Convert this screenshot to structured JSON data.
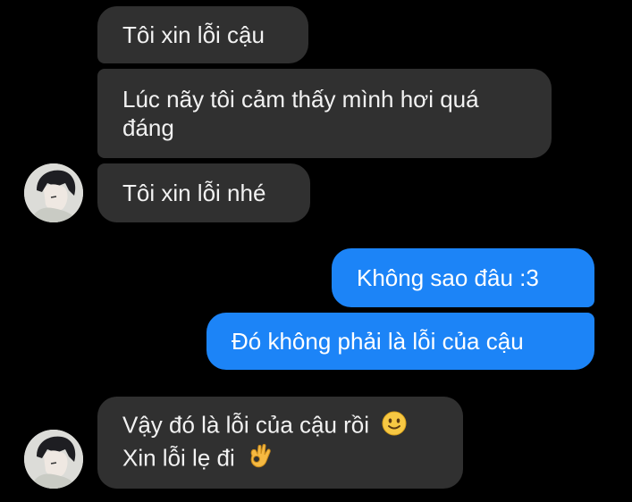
{
  "colors": {
    "background": "#000000",
    "incoming_bubble": "#303030",
    "outgoing_bubble": "#1c84f7",
    "text": "#f2f2f2"
  },
  "messages": [
    {
      "side": "incoming",
      "lines": [
        "Tôi xin lỗi cậu"
      ]
    },
    {
      "side": "incoming",
      "lines": [
        "Lúc nãy tôi cảm thấy mình hơi quá",
        "đáng"
      ]
    },
    {
      "side": "incoming",
      "lines": [
        "Tôi xin lỗi nhé"
      ]
    },
    {
      "side": "outgoing",
      "lines": [
        "Không sao đâu :3"
      ]
    },
    {
      "side": "outgoing",
      "lines": [
        "Đó không phải là lỗi của cậu"
      ]
    },
    {
      "side": "incoming",
      "lines": [
        "Vậy đó là lỗi của cậu rồi",
        "Xin lỗi lẹ đi"
      ],
      "emojis": [
        "slightly-smiling-face-emoji",
        "ok-hand-emoji"
      ]
    }
  ],
  "avatars": [
    {
      "name": "contact-avatar"
    },
    {
      "name": "contact-avatar"
    }
  ]
}
